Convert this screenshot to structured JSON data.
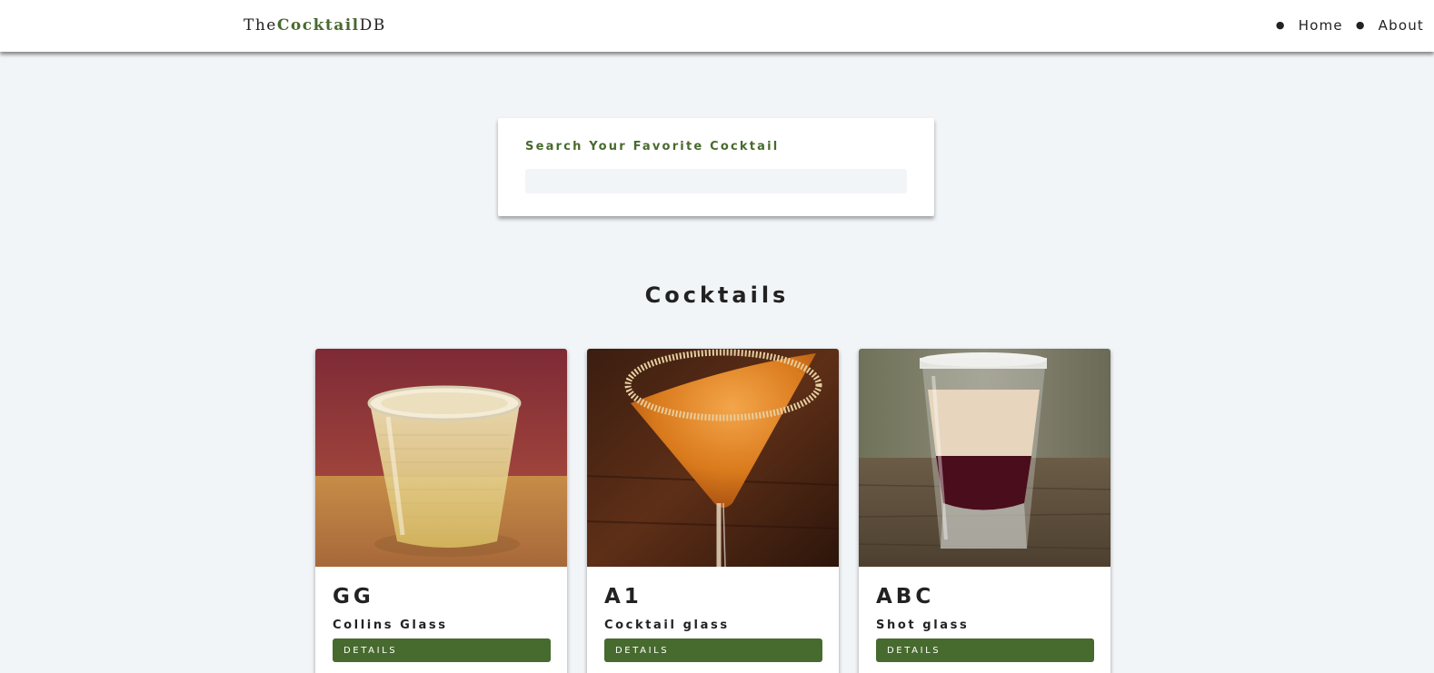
{
  "navbar": {
    "logo_prefix": "The",
    "logo_brand": "Cocktail",
    "logo_suffix": "DB",
    "links": [
      {
        "label": "Home"
      },
      {
        "label": "About"
      }
    ]
  },
  "search": {
    "label": "Search Your Favorite Cocktail",
    "value": ""
  },
  "section": {
    "title": "Cocktails"
  },
  "cocktails": [
    {
      "name": "GG",
      "glass": "Collins Glass",
      "button": "DETAILS",
      "image": "drink-in-rocks-glass"
    },
    {
      "name": "A1",
      "glass": "Cocktail glass",
      "button": "DETAILS",
      "image": "orange-martini"
    },
    {
      "name": "ABC",
      "glass": "Shot glass",
      "button": "DETAILS",
      "image": "layered-shot"
    }
  ],
  "colors": {
    "accent": "#476a2e",
    "background": "#f1f5f8",
    "text": "#222222",
    "surface": "#ffffff"
  }
}
